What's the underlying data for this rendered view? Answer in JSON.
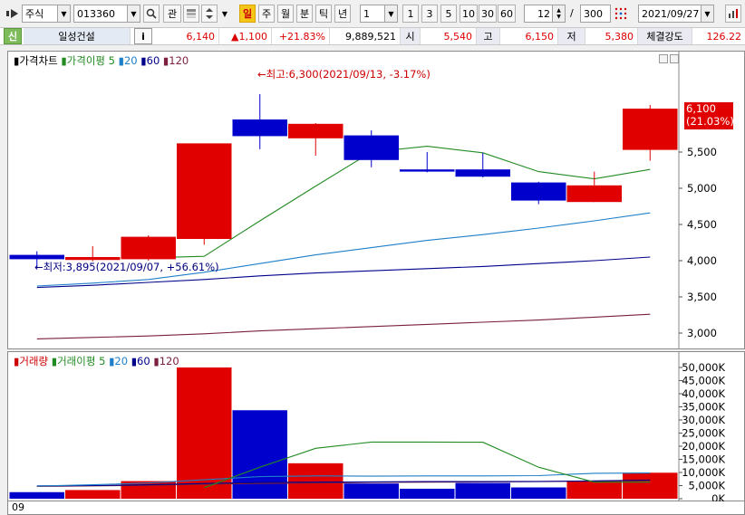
{
  "toolbar": {
    "market": "주식",
    "code": "013360",
    "gwan_label": "관",
    "periods": [
      "일",
      "주",
      "월",
      "분",
      "틱",
      "년"
    ],
    "active_period": "일",
    "interval_value": "1",
    "quick_intervals": [
      "1",
      "3",
      "5",
      "10",
      "30",
      "60"
    ],
    "view_count": "12",
    "total_count": "300",
    "date": "2021/09/27"
  },
  "info": {
    "badge": "신",
    "name": "일성건설",
    "info_button": "i",
    "price": "6,140",
    "change": "▲1,100",
    "change_rate": "+21.83%",
    "volume": "9,889,521",
    "open_label": "시",
    "open": "5,540",
    "high_label": "고",
    "high": "6,150",
    "low_label": "저",
    "low": "5,380",
    "strength_label": "체결강도",
    "strength": "126.22"
  },
  "colors": {
    "up": "#e00000",
    "down": "#0000cc",
    "ma5": "#228b22",
    "ma20": "#1e7fc8",
    "ma60": "#00008b",
    "ma120": "#7a1f3d"
  },
  "price_pane": {
    "legend": {
      "title": "가격차트",
      "ma_title": "가격이평",
      "ma_periods": [
        "5",
        "20",
        "60",
        "120"
      ]
    },
    "y_ticks": [
      "3,000",
      "3,500",
      "4,000",
      "4,500",
      "5,000",
      "5,500"
    ],
    "last_label": "6,100",
    "last_rate": "(21.03%)",
    "high_annotation": "←최고:6,300(2021/09/13, -3.17%)",
    "low_annotation": "←최저:3,895(2021/09/07, +56.61%)"
  },
  "volume_pane": {
    "legend": {
      "title": "거래량",
      "ma_title": "거래이평",
      "ma_periods": [
        "5",
        "20",
        "60",
        "120"
      ]
    },
    "y_ticks": [
      "0K",
      "5,000K",
      "10,000K",
      "15,000K",
      "20,000K",
      "25,000K",
      "30,000K",
      "35,000K",
      "40,000K",
      "45,000K",
      "50,000K"
    ],
    "x_label": "09"
  },
  "chart_data": {
    "type": "candlestick",
    "price": {
      "ylim": [
        2800,
        6700
      ],
      "candles": [
        {
          "o": 4080,
          "h": 4130,
          "l": 3895,
          "c": 4020,
          "dir": "down"
        },
        {
          "o": 4010,
          "h": 4200,
          "l": 3990,
          "c": 4050,
          "dir": "up"
        },
        {
          "o": 4020,
          "h": 4350,
          "l": 4000,
          "c": 4330,
          "dir": "up"
        },
        {
          "o": 4300,
          "h": 5620,
          "l": 4220,
          "c": 5620,
          "dir": "up"
        },
        {
          "o": 5950,
          "h": 6300,
          "l": 5540,
          "c": 5720,
          "dir": "down"
        },
        {
          "o": 5690,
          "h": 5900,
          "l": 5450,
          "c": 5890,
          "dir": "up"
        },
        {
          "o": 5730,
          "h": 5800,
          "l": 5290,
          "c": 5390,
          "dir": "down"
        },
        {
          "o": 5260,
          "h": 5500,
          "l": 5220,
          "c": 5230,
          "dir": "down"
        },
        {
          "o": 5260,
          "h": 5490,
          "l": 5150,
          "c": 5160,
          "dir": "down"
        },
        {
          "o": 5080,
          "h": 5090,
          "l": 4780,
          "c": 4830,
          "dir": "down"
        },
        {
          "o": 4810,
          "h": 5230,
          "l": 4810,
          "c": 5040,
          "dir": "up"
        },
        {
          "o": 5530,
          "h": 6150,
          "l": 5380,
          "c": 6100,
          "dir": "up"
        }
      ],
      "ma5": [
        null,
        null,
        4040,
        4060,
        4550,
        5030,
        5500,
        5580,
        5490,
        5230,
        5130,
        5260
      ],
      "ma20": [
        3650,
        3690,
        3740,
        3840,
        3960,
        4080,
        4180,
        4280,
        4360,
        4450,
        4550,
        4660
      ],
      "ma60": [
        3630,
        3660,
        3700,
        3740,
        3790,
        3830,
        3860,
        3890,
        3920,
        3960,
        4000,
        4050
      ],
      "ma120": [
        2920,
        2940,
        2960,
        2990,
        3030,
        3060,
        3090,
        3120,
        3150,
        3180,
        3220,
        3260
      ]
    },
    "volume": {
      "ylim": [
        0,
        50000
      ],
      "values": [
        2500,
        3300,
        6700,
        50000,
        33700,
        13500,
        5800,
        3800,
        6000,
        4300,
        6900,
        9900
      ],
      "ma5": [
        null,
        null,
        null,
        4200,
        12000,
        19200,
        21600,
        21600,
        21500,
        12000,
        6300,
        6300
      ],
      "ma20": [
        4800,
        5300,
        6000,
        7200,
        8400,
        8700,
        8600,
        8700,
        8700,
        8800,
        9700,
        9800
      ],
      "ma60": [
        4900,
        5000,
        5300,
        5800,
        6200,
        6300,
        6400,
        6500,
        6500,
        6600,
        6800,
        7100
      ],
      "ma120": [
        4700,
        4900,
        5100,
        5500,
        5800,
        6000,
        6200,
        6300,
        6400,
        6500,
        6700,
        7000
      ]
    }
  }
}
